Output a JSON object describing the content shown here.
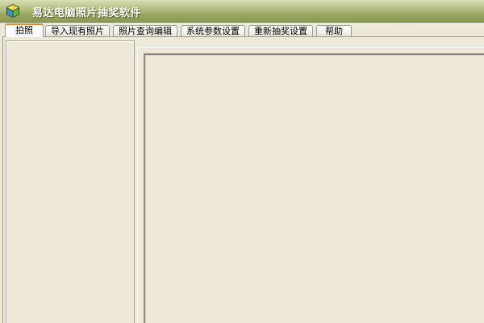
{
  "window": {
    "title": "易达电脑照片抽奖软件",
    "icon": "app-cube-icon",
    "colors": {
      "titlebar": "#96a45e",
      "titlebar_text": "#ffffff",
      "background": "#ece9d8",
      "active_tab_accent": "#e68b2c"
    }
  },
  "tabs": [
    {
      "label": "拍照",
      "active": true
    },
    {
      "label": "导入现有照片",
      "active": false
    },
    {
      "label": "照片查询编辑",
      "active": false
    },
    {
      "label": "系统参数设置",
      "active": false
    },
    {
      "label": "重新抽奖设置",
      "active": false
    },
    {
      "label": "帮助",
      "active": false
    }
  ]
}
